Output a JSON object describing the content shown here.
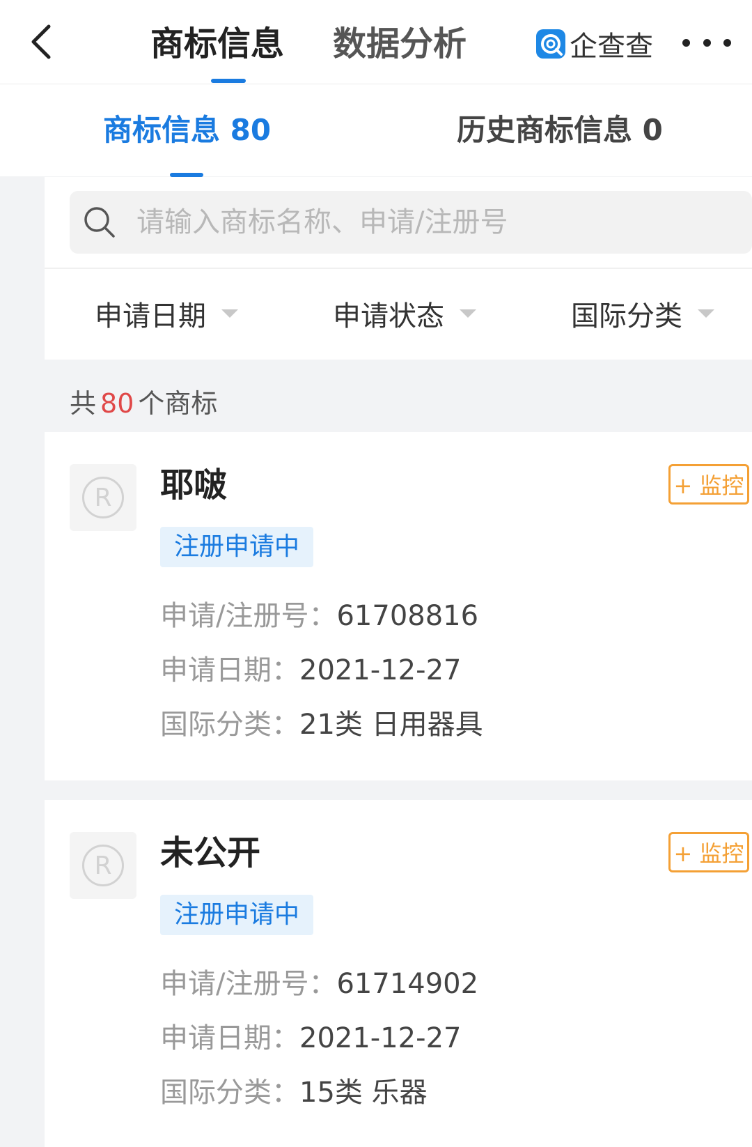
{
  "header": {
    "tabs": [
      {
        "label": "商标信息"
      },
      {
        "label": "数据分析"
      }
    ],
    "brand": "企查查"
  },
  "subtabs": [
    {
      "label": "商标信息 80"
    },
    {
      "label": "历史商标信息 0"
    }
  ],
  "search": {
    "placeholder": "请输入商标名称、申请/注册号"
  },
  "filters": [
    {
      "label": "申请日期"
    },
    {
      "label": "申请状态"
    },
    {
      "label": "国际分类"
    }
  ],
  "summary": {
    "prefix": "共",
    "count": "80",
    "suffix": "个商标"
  },
  "monitor_label": "+ 监控",
  "field_labels": {
    "reg_no": "申请/注册号：",
    "date": "申请日期：",
    "class": "国际分类："
  },
  "cards": [
    {
      "name": "耶啵",
      "status": "注册申请中",
      "reg_no": "61708816",
      "date": "2021-12-27",
      "class": "21类 日用器具"
    },
    {
      "name": "未公开",
      "status": "注册申请中",
      "reg_no": "61714902",
      "date": "2021-12-27",
      "class": "15类 乐器"
    }
  ]
}
